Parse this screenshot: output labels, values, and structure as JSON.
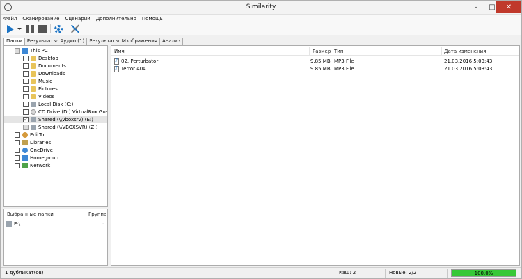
{
  "window": {
    "title": "Similarity"
  },
  "menu": [
    "Файл",
    "Сканирование",
    "Сценарии",
    "Дополнительно",
    "Помощь"
  ],
  "toolbar": {
    "icons": [
      "play-icon",
      "dropdown-caret-icon",
      "pause-icon",
      "stop-icon",
      "settings-gear-icon",
      "tools-icon"
    ]
  },
  "tabs": [
    "Папки",
    "Результаты: Аудио (1)",
    "Результаты: Изображения",
    "Анализ"
  ],
  "tree": [
    {
      "label": "This PC",
      "state": "partial",
      "icon": "pc-icon"
    },
    {
      "label": "Desktop",
      "state": "unchecked",
      "icon": "folder-icon"
    },
    {
      "label": "Documents",
      "state": "unchecked",
      "icon": "folder-icon"
    },
    {
      "label": "Downloads",
      "state": "unchecked",
      "icon": "folder-icon"
    },
    {
      "label": "Music",
      "state": "unchecked",
      "icon": "folder-icon"
    },
    {
      "label": "Pictures",
      "state": "unchecked",
      "icon": "folder-icon"
    },
    {
      "label": "Videos",
      "state": "unchecked",
      "icon": "folder-icon"
    },
    {
      "label": "Local Disk (C:)",
      "state": "unchecked",
      "icon": "disk-icon"
    },
    {
      "label": "CD Drive (D:) VirtualBox Guest A",
      "state": "unchecked",
      "icon": "cd-icon"
    },
    {
      "label": "Shared (\\\\vboxsrv) (E:)",
      "state": "checked",
      "icon": "network-drive-icon"
    },
    {
      "label": "Shared (\\\\VBOXSVR) (Z:)",
      "state": "partial",
      "icon": "network-drive-icon"
    },
    {
      "label": "Edi Tor",
      "state": "unchecked",
      "icon": "user-folder-icon"
    },
    {
      "label": "Libraries",
      "state": "unchecked",
      "icon": "libraries-icon"
    },
    {
      "label": "OneDrive",
      "state": "unchecked",
      "icon": "onedrive-icon"
    },
    {
      "label": "Homegroup",
      "state": "unchecked",
      "icon": "homegroup-icon"
    },
    {
      "label": "Network",
      "state": "unchecked",
      "icon": "network-icon"
    }
  ],
  "chosen": {
    "col_folders": "Выбранные папки",
    "col_group": "Группа",
    "rows": [
      {
        "path": "E:\\",
        "group": "-"
      }
    ]
  },
  "list": {
    "columns": [
      "Имя",
      "Размер",
      "Тип",
      "Дата изменения"
    ],
    "rows": [
      {
        "name": "02. Perturbator",
        "size": "9.85 MB",
        "type": "MP3 File",
        "date": "21.03.2016 5:03:43"
      },
      {
        "name": "Terror 404",
        "size": "9.85 MB",
        "type": "MP3 File",
        "date": "21.03.2016 5:03:43"
      }
    ]
  },
  "status": {
    "duplicates": "1 дубликат(ов)",
    "cache": "Кэш: 2",
    "new": "Новые: 2/2",
    "progress_text": "100.0%",
    "progress": 1.0
  }
}
